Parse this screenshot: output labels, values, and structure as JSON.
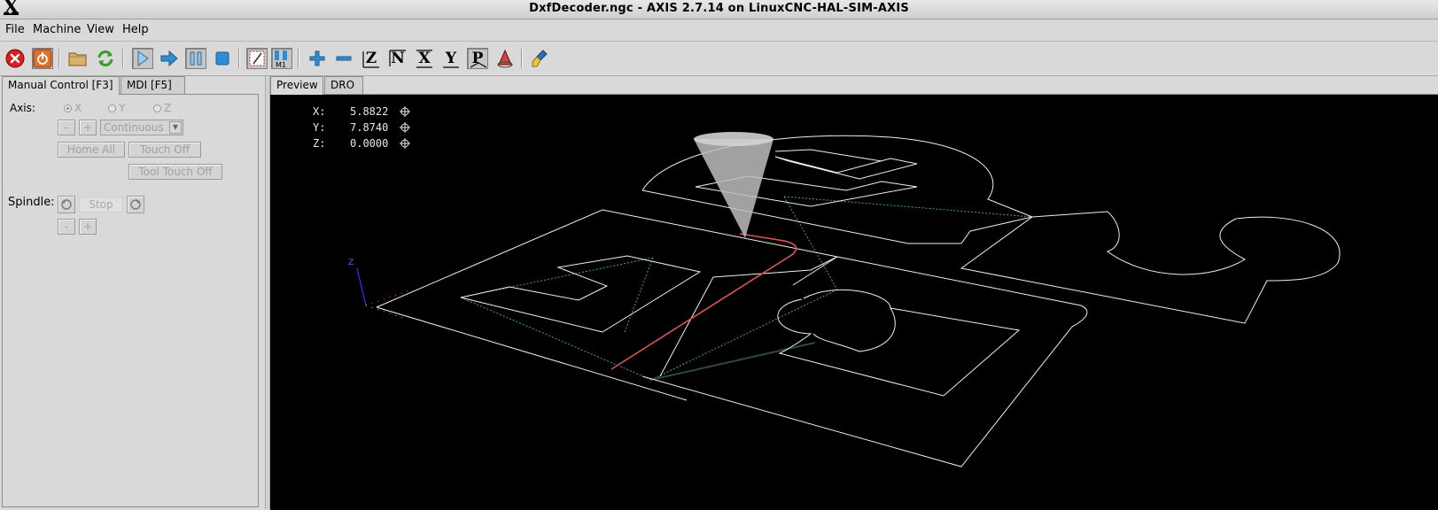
{
  "window": {
    "title": "DxfDecoder.ngc - AXIS 2.7.14 on LinuxCNC-HAL-SIM-AXIS",
    "app_glyph": "X"
  },
  "menu": [
    {
      "label": "File"
    },
    {
      "label": "Machine"
    },
    {
      "label": "View"
    },
    {
      "label": "Help"
    }
  ],
  "toolbar": {
    "icons": [
      "estop-icon",
      "power-icon",
      "open-file-icon",
      "reload-icon",
      "run-icon",
      "step-icon",
      "pause-icon",
      "stop-icon",
      "block-delete-icon",
      "optional-stop-icon",
      "zoom-in-icon",
      "zoom-out-icon",
      "view-z-icon",
      "view-z2-icon",
      "view-x-icon",
      "view-y-icon",
      "view-p-icon",
      "rotate-icon",
      "clear-plot-icon"
    ],
    "view_labels": {
      "z": "Z",
      "z2": "N",
      "x": "X",
      "y": "Y",
      "p": "P"
    },
    "optional_stop_label": "M1"
  },
  "left_tabs": [
    {
      "label": "Manual Control [F3]",
      "active": true
    },
    {
      "label": "MDI [F5]",
      "active": false
    }
  ],
  "manual": {
    "axis_label": "Axis:",
    "axes": [
      {
        "label": "X",
        "selected": true
      },
      {
        "label": "Y",
        "selected": false
      },
      {
        "label": "Z",
        "selected": false
      }
    ],
    "jog_minus": "-",
    "jog_plus": "+",
    "jog_mode": "Continuous",
    "home_all": "Home All",
    "touch_off": "Touch Off",
    "tool_touch_off": "Tool Touch Off",
    "spindle_label": "Spindle:",
    "spindle_stop": "Stop",
    "spindle_minus": "-",
    "spindle_plus": "+"
  },
  "right_tabs": [
    {
      "label": "Preview",
      "active": true
    },
    {
      "label": "DRO",
      "active": false
    }
  ],
  "dro": [
    {
      "axis": "X:",
      "value": "5.8822"
    },
    {
      "axis": "Y:",
      "value": "7.8740"
    },
    {
      "axis": "Z:",
      "value": "0.0000"
    }
  ],
  "preview": {
    "axis_label_z": "Z",
    "colors": {
      "background": "#000000",
      "feed": "#ffffff",
      "traverse": "#3fa0a0",
      "live_plot": "#e05555",
      "tool_cone": "#bdbdbd",
      "axis_x": "#ff3333",
      "axis_y": "#33ff33",
      "axis_z": "#3333ff"
    }
  }
}
